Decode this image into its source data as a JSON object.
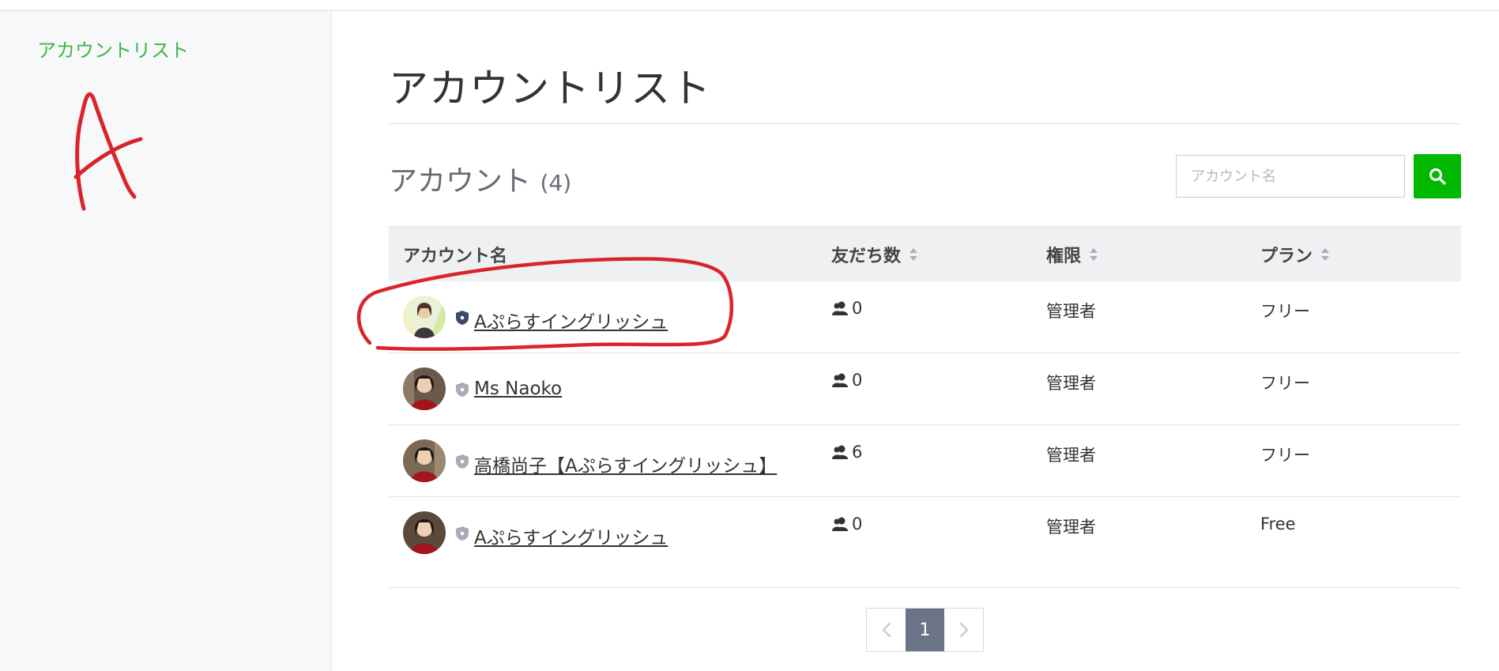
{
  "sidebar": {
    "link_label": "アカウントリスト"
  },
  "main": {
    "page_title": "アカウントリスト",
    "section_title": "アカウント",
    "section_count": "(4)",
    "search": {
      "placeholder": "アカウント名"
    }
  },
  "table": {
    "headers": {
      "name": "アカウント名",
      "friends": "友だち数",
      "role": "権限",
      "plan": "プラン"
    },
    "rows": [
      {
        "name": "Aぷらすイングリッシュ",
        "friends": "0",
        "role": "管理者",
        "plan": "フリー",
        "shield_color": "#3b4a6b"
      },
      {
        "name": "Ms Naoko",
        "friends": "0",
        "role": "管理者",
        "plan": "フリー",
        "shield_color": "#a7adb7"
      },
      {
        "name": "高橋尚子【Aぷらすイングリッシュ】",
        "friends": "6",
        "role": "管理者",
        "plan": "フリー",
        "shield_color": "#a7adb7"
      },
      {
        "name": "Aぷらすイングリッシュ",
        "friends": "0",
        "role": "管理者",
        "plan": "Free",
        "shield_color": "#a7adb7"
      }
    ]
  },
  "pagination": {
    "current_page": "1"
  },
  "colors": {
    "accent_green": "#00b900",
    "annotation_red": "#d9252a",
    "active_page": "#6b7487"
  }
}
